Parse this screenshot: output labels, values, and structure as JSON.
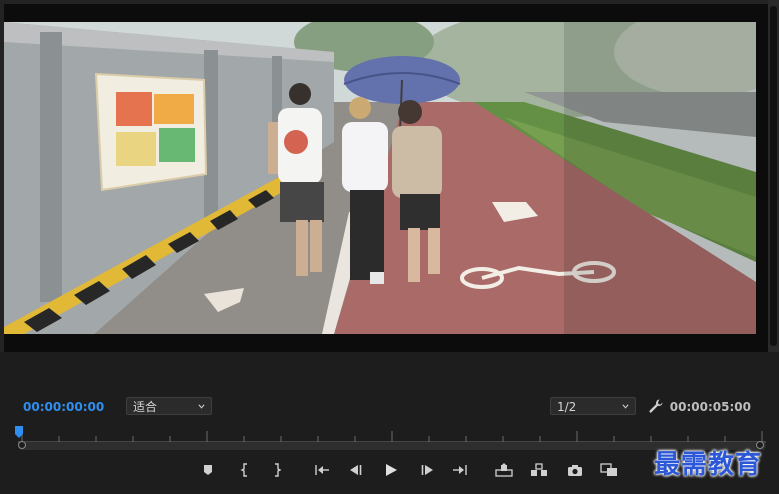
{
  "program_monitor": {
    "current_timecode": "00:00:00:00",
    "duration_timecode": "00:00:05:00",
    "fit_select": {
      "selected": "适合",
      "icon": "chevron-down-icon"
    },
    "resolution_select": {
      "selected": "1/2",
      "icon": "chevron-down-icon"
    },
    "settings_icon": "wrench-icon",
    "playhead_position": 0
  },
  "transport": {
    "buttons": [
      {
        "name": "add-marker-button",
        "icon": "marker-icon"
      },
      {
        "name": "mark-in-button",
        "icon": "mark-in-icon"
      },
      {
        "name": "mark-out-button",
        "icon": "mark-out-icon"
      },
      {
        "name": "go-to-in-button",
        "icon": "go-to-in-icon"
      },
      {
        "name": "step-back-button",
        "icon": "step-back-icon"
      },
      {
        "name": "play-button",
        "icon": "play-icon"
      },
      {
        "name": "step-forward-button",
        "icon": "step-forward-icon"
      },
      {
        "name": "go-to-out-button",
        "icon": "go-to-out-icon"
      },
      {
        "name": "lift-button",
        "icon": "lift-icon"
      },
      {
        "name": "extract-button",
        "icon": "extract-icon"
      },
      {
        "name": "export-frame-button",
        "icon": "camera-icon"
      },
      {
        "name": "compare-view-button",
        "icon": "compare-icon"
      }
    ]
  },
  "watermark": {
    "text": "最需教育"
  },
  "colors": {
    "timecode_active": "#2f8ff0",
    "panel_bg": "#1d1d1d",
    "icon": "#d0d0d0",
    "path": "#a5615f"
  }
}
